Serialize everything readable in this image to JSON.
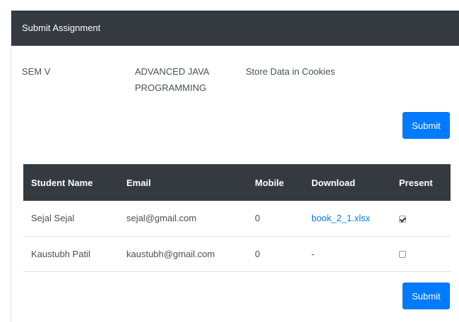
{
  "header": {
    "title": "Submit Assignment"
  },
  "info": {
    "semester": "SEM V",
    "subject": "ADVANCED JAVA PROGRAMMING",
    "assignment": "Store Data in Cookies"
  },
  "buttons": {
    "top_submit": "Submit",
    "bottom_submit": "Submit"
  },
  "table": {
    "columns": [
      "Student Name",
      "Email",
      "Mobile",
      "Download",
      "Present"
    ],
    "rows": [
      {
        "name": "Sejal Sejal",
        "email": "sejal@gmail.com",
        "mobile": "0",
        "download": "book_2_1.xlsx",
        "present": true
      },
      {
        "name": "Kaustubh Patil",
        "email": "kaustubh@gmail.com",
        "mobile": "0",
        "download": "-",
        "present": false
      }
    ]
  },
  "colors": {
    "header_bg": "#343a40",
    "primary": "#007bff",
    "link": "#007bff"
  }
}
